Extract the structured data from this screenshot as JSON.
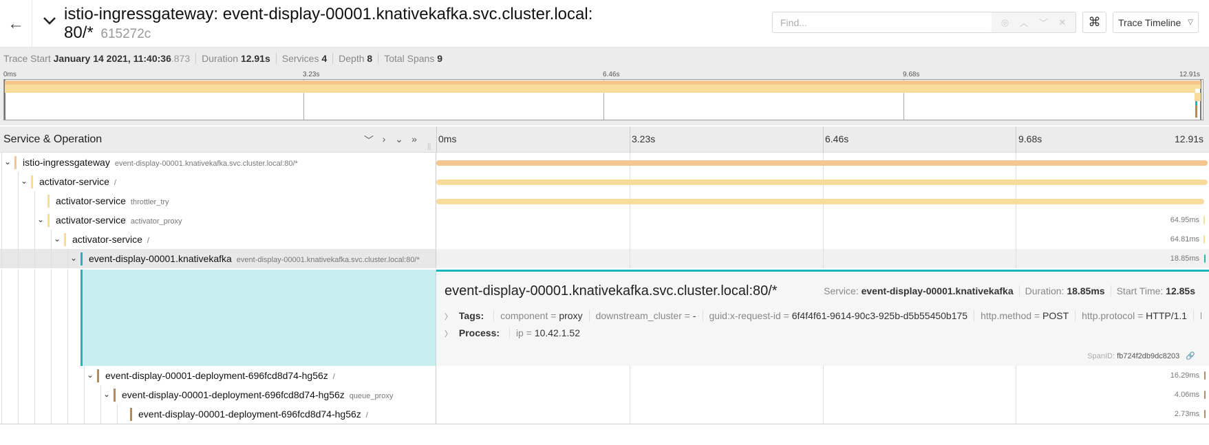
{
  "header": {
    "title": "istio-ingressgateway: event-display-00001.knativekafka.svc.cluster.local: 80/*",
    "trace_id": "615272c",
    "find_placeholder": "Find...",
    "keyboard_icon": "⌘",
    "view_label": "Trace Timeline"
  },
  "summary": {
    "trace_start_label": "Trace Start",
    "trace_start_value": "January 14 2021, 11:40:36",
    "trace_start_ms": ".873",
    "duration_label": "Duration",
    "duration_value": "12.91s",
    "services_label": "Services",
    "services_value": "4",
    "depth_label": "Depth",
    "depth_value": "8",
    "total_spans_label": "Total Spans",
    "total_spans_value": "9"
  },
  "minimap": {
    "ticks": [
      "0ms",
      "3.23s",
      "6.46s",
      "9.68s",
      "12.91s"
    ]
  },
  "timeline": {
    "title": "Service & Operation",
    "ticks": [
      "0ms",
      "3.23s",
      "6.46s",
      "9.68s",
      "12.91s"
    ],
    "total_s": 12.91
  },
  "colors": {
    "istio-ingressgateway": "#f5c68e",
    "activator-service": "#f8dc9b",
    "event-display-00001.knativekafka": "#17b8be",
    "event-display-00001-deployment-696fcd8d74-hg56z": "#b38a58"
  },
  "spans": [
    {
      "service": "istio-ingressgateway",
      "operation": "event-display-00001.knativekafka.svc.cluster.local:80/*",
      "depth": 0,
      "start_s": 0,
      "duration_s": 12.91,
      "label": "",
      "toggle": true
    },
    {
      "service": "activator-service",
      "operation": "/",
      "depth": 1,
      "start_s": 0,
      "duration_s": 12.91,
      "label": "",
      "toggle": true
    },
    {
      "service": "activator-service",
      "operation": "throttler_try",
      "depth": 2,
      "start_s": 0,
      "duration_s": 12.85,
      "label": "",
      "toggle": false
    },
    {
      "service": "activator-service",
      "operation": "activator_proxy",
      "depth": 2,
      "start_s": 12.845,
      "duration_s": 0.06495,
      "label": "64.95ms",
      "toggle": true
    },
    {
      "service": "activator-service",
      "operation": "/",
      "depth": 3,
      "start_s": 12.845,
      "duration_s": 0.06481,
      "label": "64.81ms",
      "toggle": true
    },
    {
      "service": "event-display-00001.knativekafka",
      "operation": "event-display-00001.knativekafka.svc.cluster.local:80/*",
      "depth": 4,
      "start_s": 12.85,
      "duration_s": 0.01885,
      "label": "18.85ms",
      "toggle": true,
      "selected": true
    },
    {
      "service": "event-display-00001-deployment-696fcd8d74-hg56z",
      "operation": "/",
      "depth": 5,
      "start_s": 12.852,
      "duration_s": 0.01629,
      "label": "16.29ms",
      "toggle": true
    },
    {
      "service": "event-display-00001-deployment-696fcd8d74-hg56z",
      "operation": "queue_proxy",
      "depth": 6,
      "start_s": 12.853,
      "duration_s": 0.00406,
      "label": "4.06ms",
      "toggle": true
    },
    {
      "service": "event-display-00001-deployment-696fcd8d74-hg56z",
      "operation": "/",
      "depth": 7,
      "start_s": 12.854,
      "duration_s": 0.00273,
      "label": "2.73ms",
      "toggle": false
    }
  ],
  "detail": {
    "title": "event-display-00001.knativekafka.svc.cluster.local:80/*",
    "service_label": "Service:",
    "service_value": "event-display-00001.knativekafka",
    "duration_label": "Duration:",
    "duration_value": "18.85ms",
    "start_label": "Start Time:",
    "start_value": "12.85s",
    "tags_label": "Tags:",
    "tags": [
      {
        "k": "component",
        "v": "proxy"
      },
      {
        "k": "downstream_cluster",
        "v": "-"
      },
      {
        "k": "guid:x-request-id",
        "v": "6f4f4f61-9614-90c3-925b-d5b55450b175"
      },
      {
        "k": "http.method",
        "v": "POST"
      },
      {
        "k": "http.protocol",
        "v": "HTTP/1.1"
      },
      {
        "k": "ht...",
        "v": ""
      }
    ],
    "process_label": "Process:",
    "process": [
      {
        "k": "ip",
        "v": "10.42.1.52"
      }
    ],
    "span_id_label": "SpanID:",
    "span_id_value": "fb724f2db9dc8203"
  }
}
